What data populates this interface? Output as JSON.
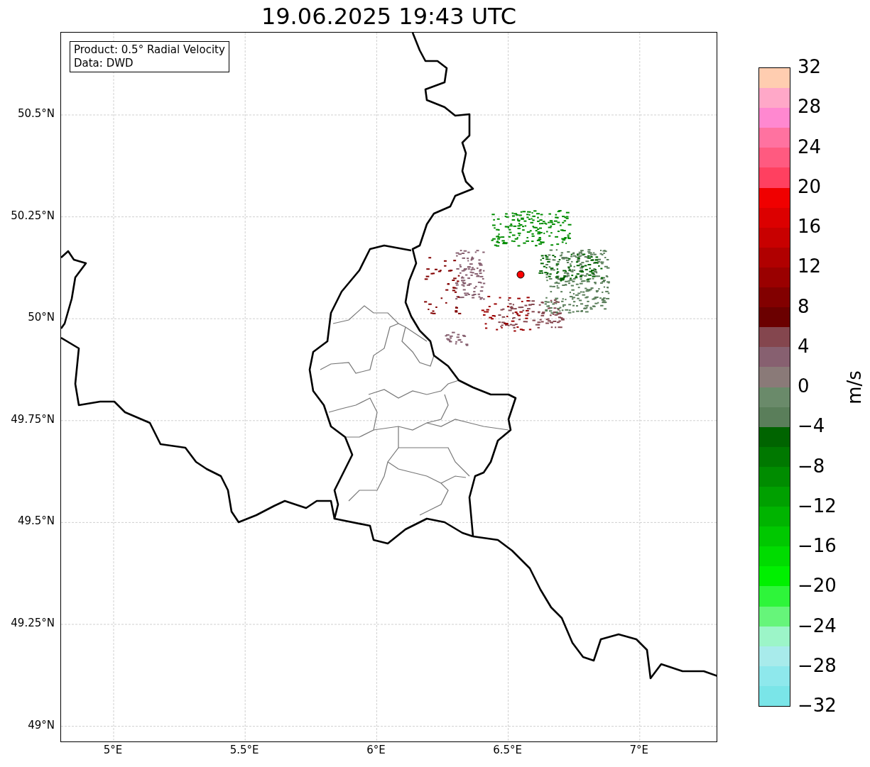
{
  "title": "19.06.2025 19:43 UTC",
  "info_box": [
    "Product: 0.5° Radial Velocity",
    "Data: DWD"
  ],
  "map": {
    "lat_ticks": [
      "50.5°N",
      "50.25°N",
      "50°N",
      "49.75°N",
      "49.5°N",
      "49.25°N",
      "49°N"
    ],
    "lon_ticks": [
      "5°E",
      "5.5°E",
      "6°E",
      "6.5°E",
      "7°E"
    ]
  },
  "colorbar": {
    "label": "m/s",
    "ticks": [
      "32",
      "28",
      "24",
      "20",
      "16",
      "12",
      "8",
      "4",
      "0",
      "−4",
      "−8",
      "−12",
      "−16",
      "−20",
      "−24",
      "−28",
      "−32"
    ],
    "segments": [
      {
        "color": "#ffcdb0"
      },
      {
        "color": "#ffa8c8"
      },
      {
        "color": "#ff88d0"
      },
      {
        "color": "#ff72a0"
      },
      {
        "color": "#ff5a80"
      },
      {
        "color": "#ff4060"
      },
      {
        "color": "#f00000"
      },
      {
        "color": "#dc0000"
      },
      {
        "color": "#c80000"
      },
      {
        "color": "#b00000"
      },
      {
        "color": "#9a0000"
      },
      {
        "color": "#820000"
      },
      {
        "color": "#6b0000"
      },
      {
        "color": "#84464e"
      },
      {
        "color": "#876070"
      },
      {
        "color": "#8a7a78"
      },
      {
        "color": "#6a8a6a"
      },
      {
        "color": "#5a7e5a"
      },
      {
        "color": "#006400"
      },
      {
        "color": "#007800"
      },
      {
        "color": "#008c00"
      },
      {
        "color": "#00a000"
      },
      {
        "color": "#00b400"
      },
      {
        "color": "#00c800"
      },
      {
        "color": "#00dc00"
      },
      {
        "color": "#00f000"
      },
      {
        "color": "#2ef53a"
      },
      {
        "color": "#66f57a"
      },
      {
        "color": "#9cf5c8"
      },
      {
        "color": "#a8ebeb"
      },
      {
        "color": "#8ee8ec"
      },
      {
        "color": "#7ae5e8"
      }
    ]
  }
}
